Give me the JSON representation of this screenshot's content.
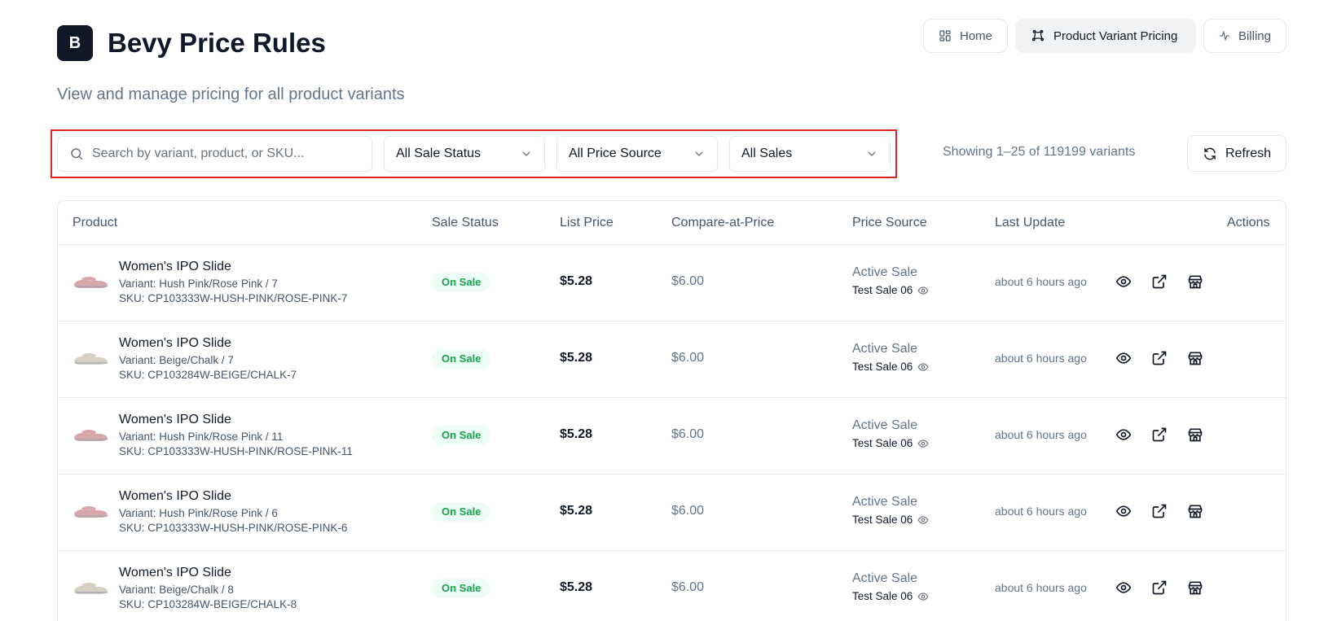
{
  "app": {
    "logo_letter": "B",
    "title": "Bevy Price Rules",
    "subtitle": "View and manage pricing for all product variants"
  },
  "nav": [
    {
      "label": "Home",
      "icon": "grid-icon",
      "active": false
    },
    {
      "label": "Product Variant Pricing",
      "icon": "badge-icon",
      "active": true
    },
    {
      "label": "Billing",
      "icon": "activity-icon",
      "active": false
    }
  ],
  "filters": {
    "search_placeholder": "Search by variant, product, or SKU...",
    "sale_status": "All Sale Status",
    "price_source": "All Price Source",
    "sales": "All Sales"
  },
  "showing_text": "Showing 1–25 of 119199 variants",
  "refresh_label": "Refresh",
  "table": {
    "headers": {
      "product": "Product",
      "sale_status": "Sale Status",
      "list_price": "List Price",
      "compare": "Compare-at-Price",
      "price_source": "Price Source",
      "last_update": "Last Update",
      "actions": "Actions"
    },
    "rows": [
      {
        "name": "Women's IPO Slide",
        "variant": "Variant: Hush Pink/Rose Pink / 7",
        "sku": "SKU: CP103333W-HUSH-PINK/ROSE-PINK-7",
        "status": "On Sale",
        "list_price": "$5.28",
        "compare": "$6.00",
        "source": "Active Sale",
        "sale": "Test Sale 06",
        "updated": "about 6 hours ago",
        "color": "#d8a7aa"
      },
      {
        "name": "Women's IPO Slide",
        "variant": "Variant: Beige/Chalk / 7",
        "sku": "SKU: CP103284W-BEIGE/CHALK-7",
        "status": "On Sale",
        "list_price": "$5.28",
        "compare": "$6.00",
        "source": "Active Sale",
        "sale": "Test Sale 06",
        "updated": "about 6 hours ago",
        "color": "#d6d0c3"
      },
      {
        "name": "Women's IPO Slide",
        "variant": "Variant: Hush Pink/Rose Pink / 11",
        "sku": "SKU: CP103333W-HUSH-PINK/ROSE-PINK-11",
        "status": "On Sale",
        "list_price": "$5.28",
        "compare": "$6.00",
        "source": "Active Sale",
        "sale": "Test Sale 06",
        "updated": "about 6 hours ago",
        "color": "#d8a7aa"
      },
      {
        "name": "Women's IPO Slide",
        "variant": "Variant: Hush Pink/Rose Pink / 6",
        "sku": "SKU: CP103333W-HUSH-PINK/ROSE-PINK-6",
        "status": "On Sale",
        "list_price": "$5.28",
        "compare": "$6.00",
        "source": "Active Sale",
        "sale": "Test Sale 06",
        "updated": "about 6 hours ago",
        "color": "#d8a7aa"
      },
      {
        "name": "Women's IPO Slide",
        "variant": "Variant: Beige/Chalk / 8",
        "sku": "SKU: CP103284W-BEIGE/CHALK-8",
        "status": "On Sale",
        "list_price": "$5.28",
        "compare": "$6.00",
        "source": "Active Sale",
        "sale": "Test Sale 06",
        "updated": "about 6 hours ago",
        "color": "#d6d0c3"
      }
    ]
  }
}
